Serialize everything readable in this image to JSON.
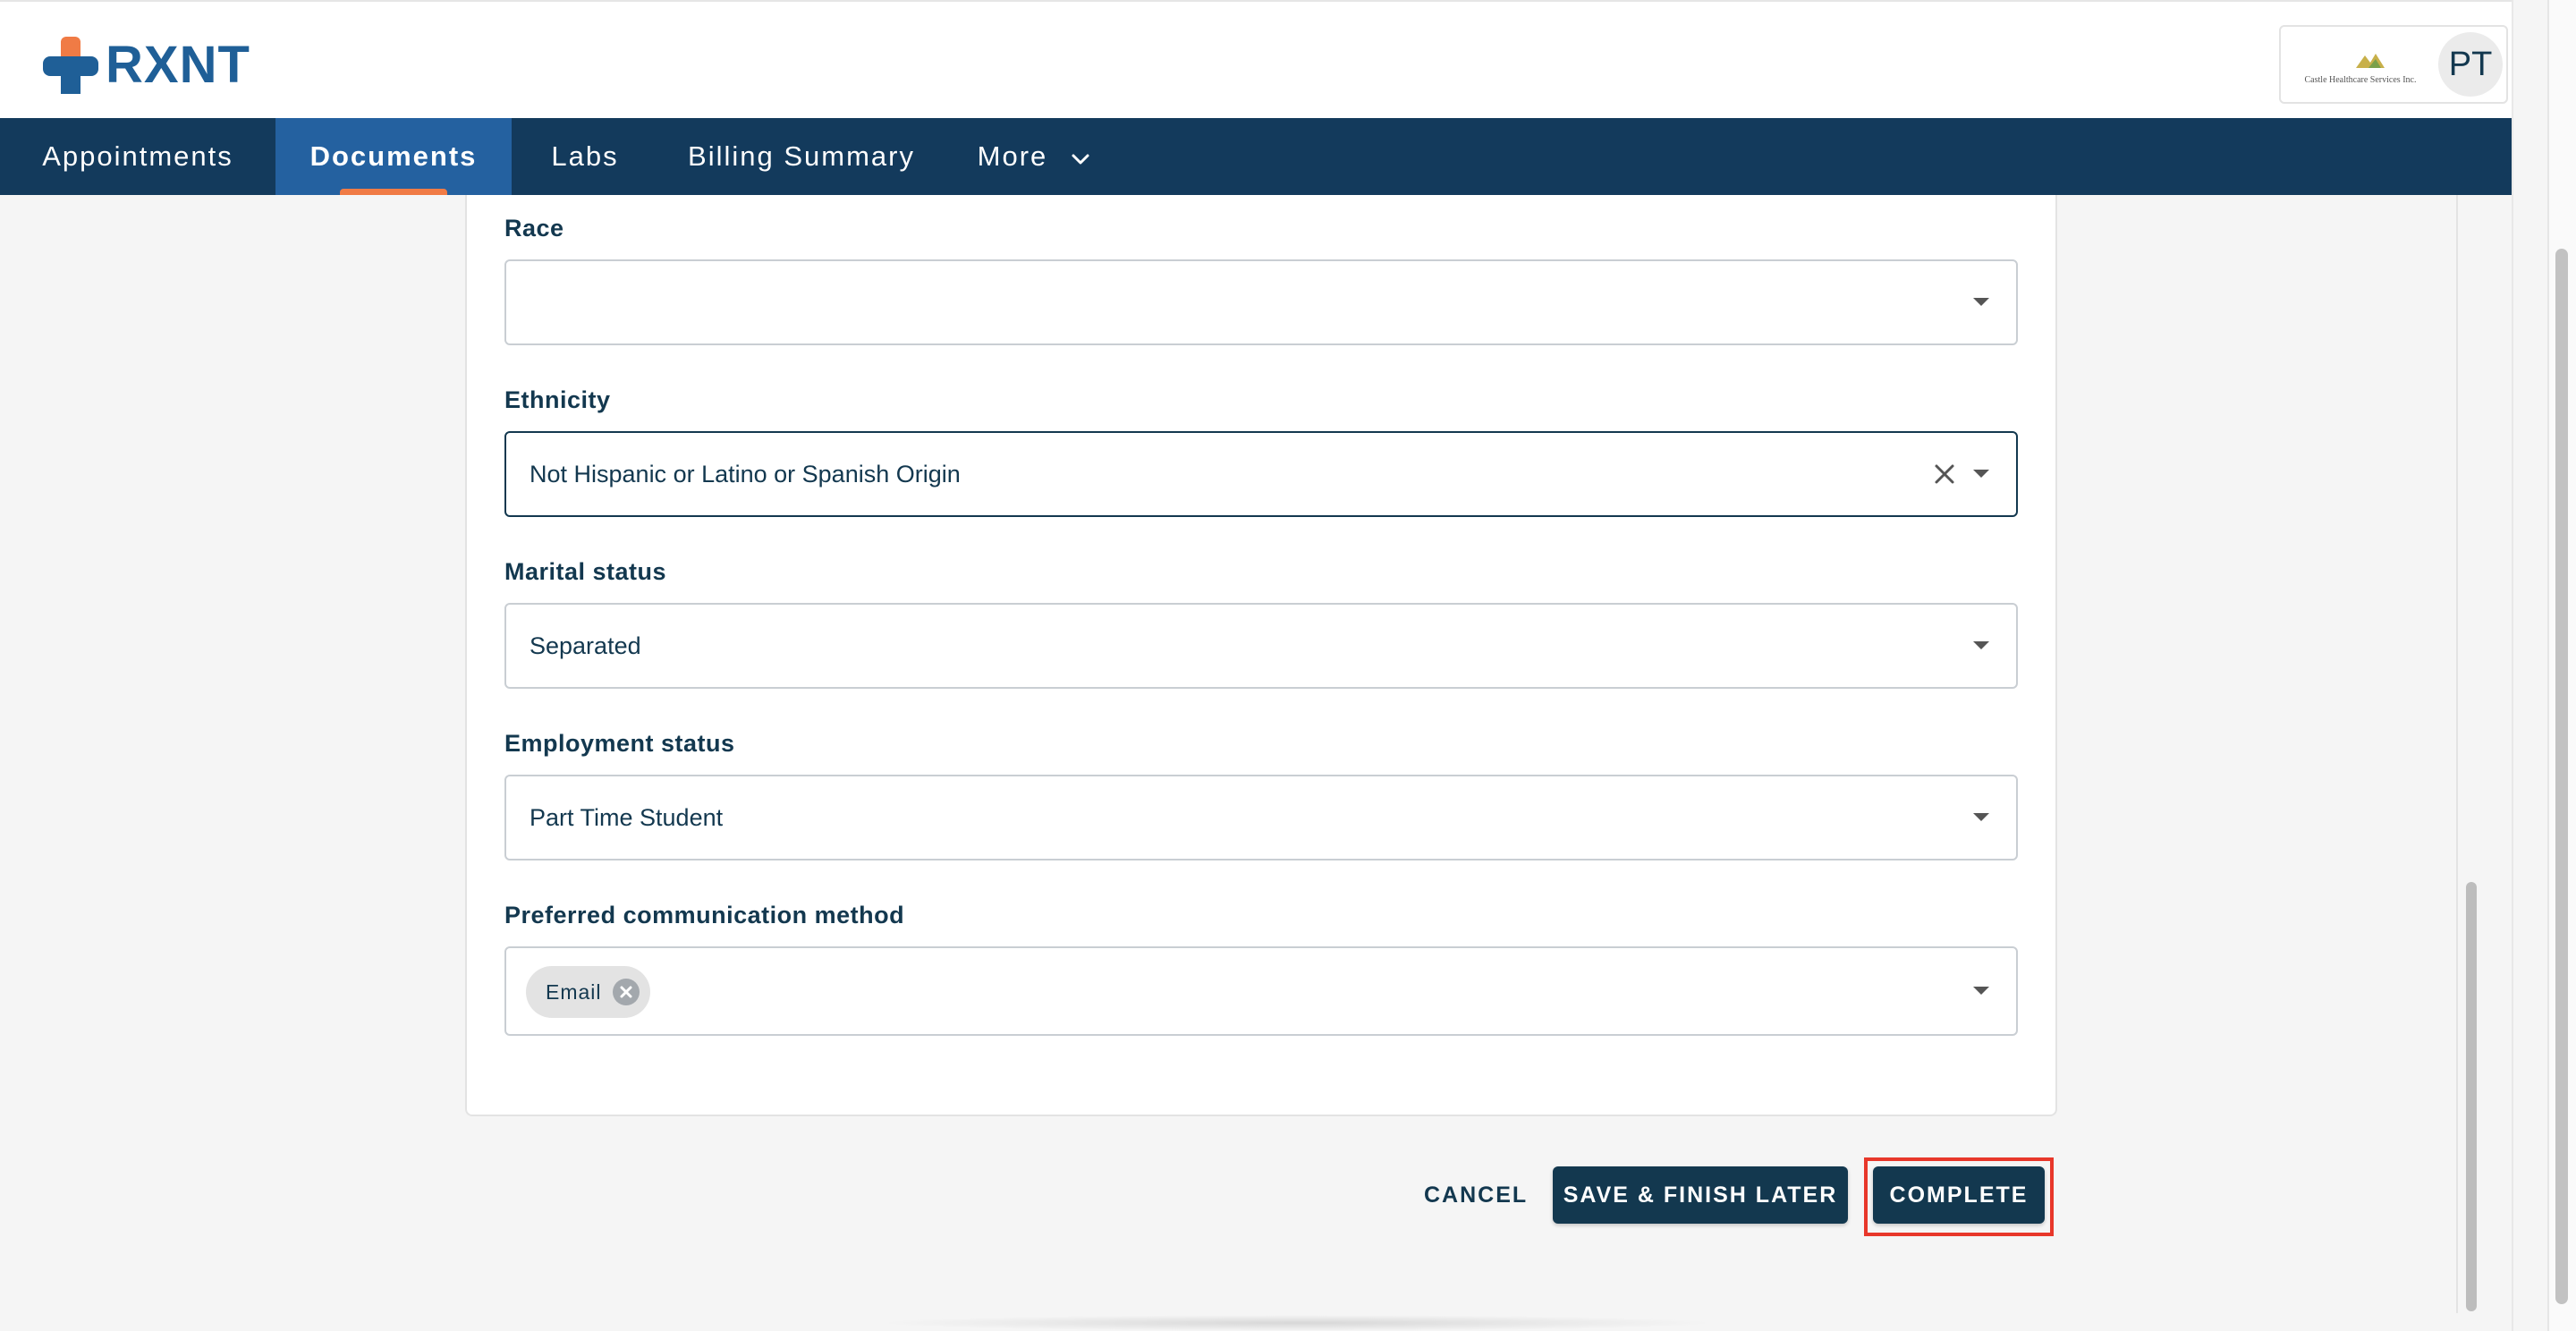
{
  "app": {
    "brand": "RXNT",
    "org_name": "Castle Healthcare Services Inc.",
    "user_initials": "PT"
  },
  "nav": {
    "items": [
      {
        "label": "Appointments"
      },
      {
        "label": "Documents"
      },
      {
        "label": "Labs"
      },
      {
        "label": "Billing Summary"
      },
      {
        "label": "More"
      }
    ],
    "active": "Documents"
  },
  "form": {
    "race": {
      "label": "Race",
      "value": ""
    },
    "ethnicity": {
      "label": "Ethnicity",
      "value": "Not Hispanic or Latino or Spanish Origin"
    },
    "marital_status": {
      "label": "Marital status",
      "value": "Separated"
    },
    "employment_status": {
      "label": "Employment status",
      "value": "Part Time Student"
    },
    "preferred_communication": {
      "label": "Preferred communication method",
      "chips": [
        "Email"
      ]
    }
  },
  "actions": {
    "cancel": "CANCEL",
    "save_later": "SAVE & FINISH LATER",
    "complete": "COMPLETE"
  },
  "colors": {
    "primary": "#13384f",
    "nav_bg": "#133a5c",
    "nav_active": "#2461a0",
    "accent": "#f07b45",
    "highlight": "#e8372a",
    "brand_blue": "#1f5f97"
  },
  "icons": {
    "logo": "rxnt-cross-icon",
    "clear": "close-icon",
    "dropdown": "caret-down-icon",
    "more": "chevron-down-icon",
    "chip_remove": "remove-chip-icon"
  }
}
